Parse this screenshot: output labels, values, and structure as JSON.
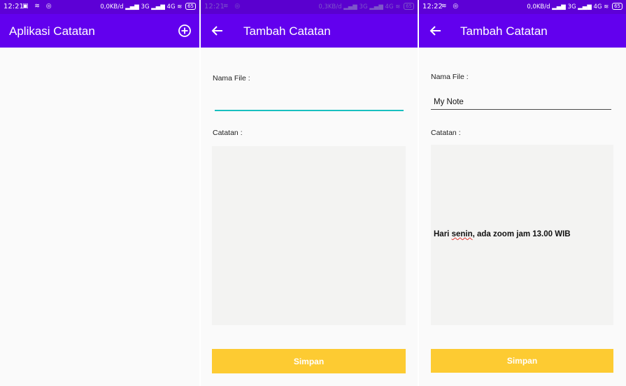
{
  "status_left": {
    "time": "12:21",
    "icons": "▣ ≋ ◎"
  },
  "status_mid": {
    "time": "12:21",
    "icons": "≋ ◎"
  },
  "status_right": {
    "time": "12:22",
    "icons": "≋ ◎"
  },
  "status_net_left": "0,0KB/d",
  "status_net_mid": "0,3KB/d",
  "status_net_right": "0,0KB/d",
  "status_signal": "▂▄▆ 3G ▂▄▆ 4G ≋",
  "battery": "65",
  "screen_list": {
    "title": "Aplikasi Catatan",
    "add_icon": "plus-circle-icon"
  },
  "screen_add_empty": {
    "title": "Tambah Catatan",
    "back_icon": "arrow-left-icon",
    "name_label": "Nama File :",
    "name_value": "",
    "note_label": "Catatan :",
    "note_value": "",
    "save_label": "Simpan"
  },
  "screen_add_filled": {
    "title": "Tambah Catatan",
    "back_icon": "arrow-left-icon",
    "name_label": "Nama File :",
    "name_value": "My Note",
    "note_label": "Catatan :",
    "note_before": "Hari ",
    "note_misspelled": "senin",
    "note_after": ", ada zoom jam 13.00 WIB",
    "save_label": "Simpan"
  },
  "colors": {
    "app_bar": "#6200ee",
    "status_bar": "#5d00d6",
    "save_button": "#fdcb32",
    "input_focus": "#18c0c0",
    "note_area": "#f3f3f2"
  }
}
